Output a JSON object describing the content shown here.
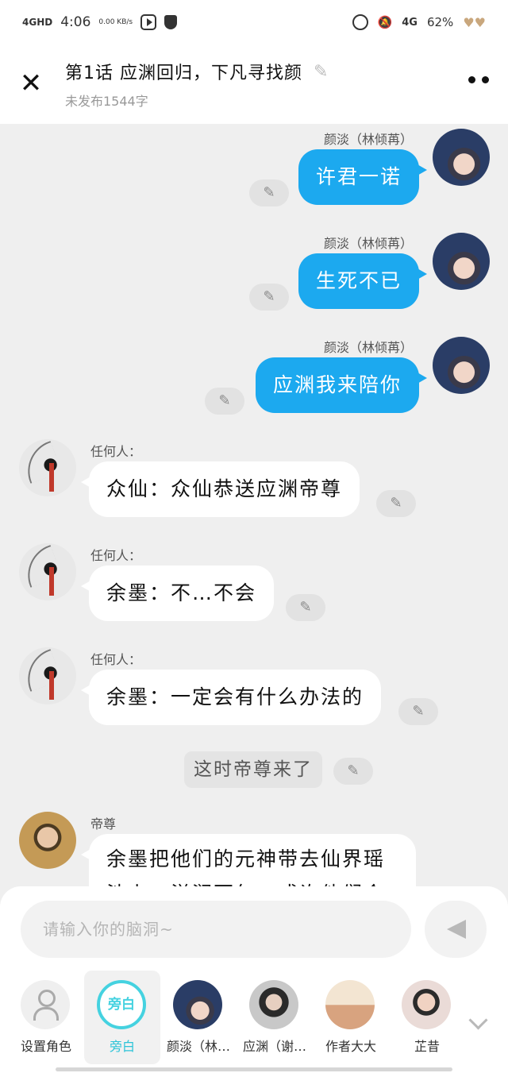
{
  "status_bar": {
    "signal": "4GHD",
    "time": "4:06",
    "speed": "0.00\nKB/s",
    "network": "4G",
    "battery": "62%"
  },
  "header": {
    "title": "第1话 应渊回归，下凡寻找颜",
    "subtitle": "未发布1544字"
  },
  "messages": [
    {
      "side": "right",
      "speaker": "颜淡（林倾苒）",
      "text": "许君一诺"
    },
    {
      "side": "right",
      "speaker": "颜淡（林倾苒）",
      "text": "生死不已"
    },
    {
      "side": "right",
      "speaker": "颜淡（林倾苒）",
      "text": "应渊我来陪你"
    },
    {
      "side": "left",
      "speaker": "任何人：",
      "text": "众仙：众仙恭送应渊帝尊"
    },
    {
      "side": "left",
      "speaker": "任何人：",
      "text": "余墨：不…不会"
    },
    {
      "side": "left",
      "speaker": "任何人：",
      "text": "余墨：一定会有什么办法的"
    },
    {
      "side": "narration",
      "text": "这时帝尊来了"
    },
    {
      "side": "left",
      "speaker": "帝尊",
      "text": "余墨把他们的元神带去仙界瑶池上，滋润百年，或许他们会"
    }
  ],
  "input": {
    "placeholder": "请输入你的脑洞~"
  },
  "roles": [
    {
      "label": "设置角色",
      "icon": "user-settings-icon"
    },
    {
      "label": "旁白",
      "icon_text": "旁白",
      "active": true
    },
    {
      "label": "颜淡（林…"
    },
    {
      "label": "应渊（谢…"
    },
    {
      "label": "作者大大"
    },
    {
      "label": "芷昔"
    }
  ],
  "colors": {
    "right_bubble": "#1ca9ef",
    "active_role": "#2cc4d8",
    "background": "#efefef"
  }
}
